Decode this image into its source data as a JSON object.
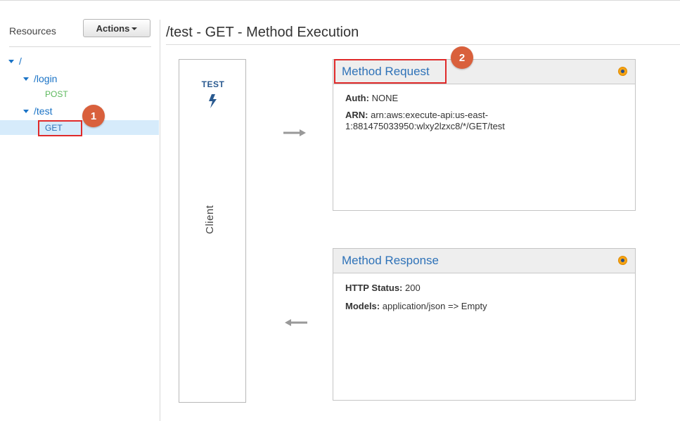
{
  "sidebar": {
    "resources_label": "Resources",
    "actions_label": "Actions",
    "tree": {
      "root": "/",
      "login": "/login",
      "login_post": "POST",
      "test": "/test",
      "test_get": "GET"
    }
  },
  "page": {
    "title": "/test - GET - Method Execution"
  },
  "client": {
    "test_label": "TEST",
    "label": "Client"
  },
  "method_request": {
    "title": "Method Request",
    "auth_key": "Auth:",
    "auth_value": "NONE",
    "arn_key": "ARN:",
    "arn_value_line1": "arn:aws:execute-api:us-east-",
    "arn_value_line2": "1:881475033950:wlxy2lzxc8/*/GET/test"
  },
  "method_response": {
    "title": "Method Response",
    "status_key": "HTTP Status:",
    "status_value": "200",
    "models_key": "Models:",
    "models_value": "application/json => Empty"
  },
  "annotations": {
    "step1": "1",
    "step2": "2"
  },
  "colors": {
    "link_blue": "#2e72b8",
    "post_green": "#5cb85c",
    "annotation_red": "#e02a2a",
    "badge_orange": "#d9603c",
    "selection_blue": "#d6ebfb"
  }
}
